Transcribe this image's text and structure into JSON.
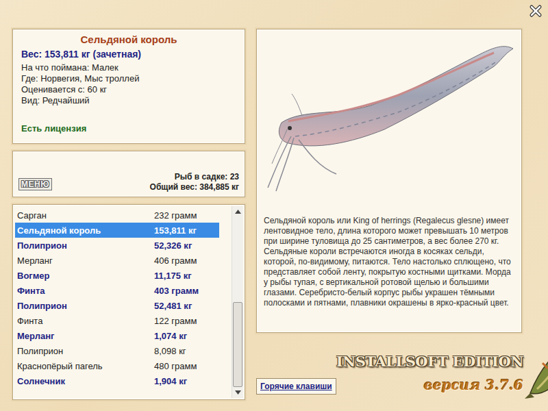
{
  "fish": {
    "title": "Сельдяной король",
    "weight": "Вес: 153,811 кг (зачетная)",
    "details": [
      "На что поймана: Малек",
      "Где: Норвегия, Мыс троллей",
      "Оценивается с: 60 кг",
      "Вид: Редчайший"
    ],
    "license": "Есть лицензия"
  },
  "cage": {
    "menu": "МЕНЮ",
    "count": "Рыб в садке: 23",
    "total": "Общий вес: 384,885 кг"
  },
  "list": {
    "rows": [
      {
        "name": "Сарган",
        "weight": "232 грамм",
        "selected": false,
        "trophy": false
      },
      {
        "name": "Сельдяной король",
        "weight": "153,811 кг",
        "selected": true,
        "trophy": true
      },
      {
        "name": "Полиприон",
        "weight": "52,326 кг",
        "selected": false,
        "trophy": true
      },
      {
        "name": "Мерланг",
        "weight": "406 грамм",
        "selected": false,
        "trophy": false
      },
      {
        "name": "Вогмер",
        "weight": "11,175 кг",
        "selected": false,
        "trophy": true
      },
      {
        "name": "Финта",
        "weight": "403 грамм",
        "selected": false,
        "trophy": true
      },
      {
        "name": "Полиприон",
        "weight": "52,481 кг",
        "selected": false,
        "trophy": true
      },
      {
        "name": "Финта",
        "weight": "122 грамм",
        "selected": false,
        "trophy": false
      },
      {
        "name": "Мерланг",
        "weight": "1,074 кг",
        "selected": false,
        "trophy": true
      },
      {
        "name": "Полиприон",
        "weight": "8,098 кг",
        "selected": false,
        "trophy": false
      },
      {
        "name": "Краснопёрый пагель",
        "weight": "480 грамм",
        "selected": false,
        "trophy": false
      },
      {
        "name": "Солнечник",
        "weight": "1,904 кг",
        "selected": false,
        "trophy": true
      }
    ],
    "scroll": {
      "level": 1,
      "thumb": 0.5
    }
  },
  "description": "Сельдяной король или King of herrings (Regalecus glesne) имеет лентовидное тело, длина которого может превышать 10 метров при ширине туловища до 25 сантиметров, а вес более 270 кг. Сельдяные короли встречаются иногда в косяках сельди, которой, по-видимому, питаются. Тело настолько сплющено, что представляет собой ленту, покрытую костными щитками. Морда у рыбы тупая, с вертикальной ротовой щелью и большими глазами. Серебристо-белый корпус рыбы украшен тёмными полосками и пятнами, плавники окрашены в ярко-красный цвет.",
  "hotkeys": "Горячие клавиши",
  "logo": {
    "title": "INSTALLSOFT EDITION",
    "version": "версия 3.7.6"
  }
}
